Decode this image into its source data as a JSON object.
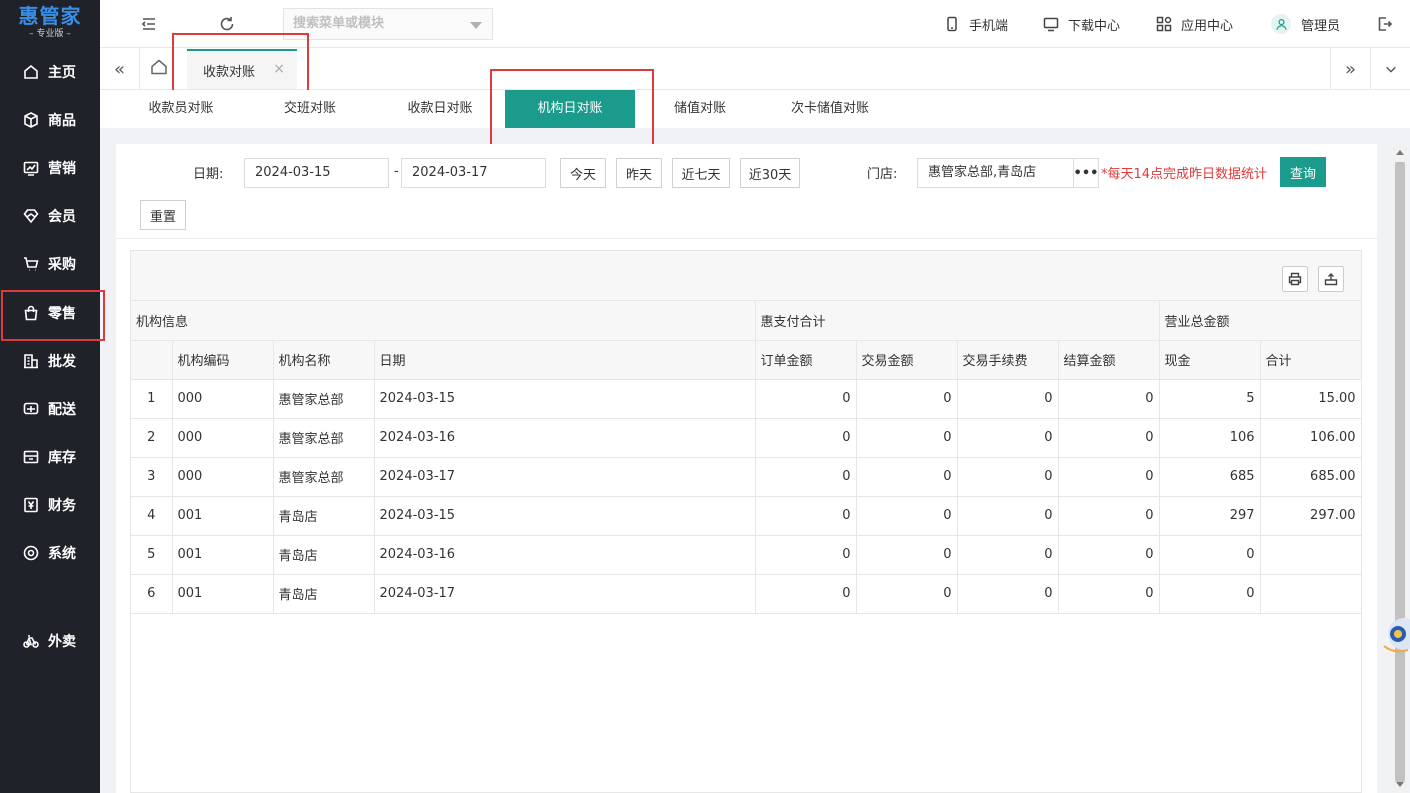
{
  "brand": {
    "name": "惠管家",
    "edition": "– 专业版 –"
  },
  "sidebar": {
    "items": [
      {
        "label": "主页",
        "icon": "home-icon"
      },
      {
        "label": "商品",
        "icon": "box-icon"
      },
      {
        "label": "营销",
        "icon": "chart-icon"
      },
      {
        "label": "会员",
        "icon": "diamond-icon"
      },
      {
        "label": "采购",
        "icon": "cart-icon"
      },
      {
        "label": "零售",
        "icon": "bag-icon"
      },
      {
        "label": "批发",
        "icon": "building-icon"
      },
      {
        "label": "配送",
        "icon": "truck-icon"
      },
      {
        "label": "库存",
        "icon": "inventory-icon"
      },
      {
        "label": "财务",
        "icon": "yen-icon"
      },
      {
        "label": "系统",
        "icon": "settings-icon"
      },
      {
        "label": "外卖",
        "icon": "bike-icon"
      }
    ]
  },
  "header": {
    "search_placeholder": "搜索菜单或模块",
    "mobile": "手机端",
    "download": "下载中心",
    "apps": "应用中心",
    "user": "管理员"
  },
  "tabs": {
    "active": "收款对账",
    "close": "×",
    "left_arrow": "«",
    "right_arrow": "»",
    "dropdown": "⌄"
  },
  "subnav": [
    "收款员对账",
    "交班对账",
    "收款日对账",
    "机构日对账",
    "储值对账",
    "次卡储值对账"
  ],
  "filters": {
    "date_label": "日期:",
    "date_from": "2024-03-15",
    "date_sep": "-",
    "date_to": "2024-03-17",
    "today": "今天",
    "yesterday": "昨天",
    "last7": "近七天",
    "last30": "近30天",
    "store_label": "门店:",
    "store_value": "惠管家总部,青岛店",
    "more": "•••",
    "hint": "*每天14点完成昨日数据统计",
    "query": "查询",
    "reset": "重置"
  },
  "table": {
    "group_headers": [
      "机构信息",
      "惠支付合计",
      "营业总金额"
    ],
    "columns": [
      "",
      "机构编码",
      "机构名称",
      "日期",
      "订单金额",
      "交易金额",
      "交易手续费",
      "结算金额",
      "现金",
      "合计"
    ],
    "rows": [
      [
        "1",
        "000",
        "惠管家总部",
        "2024-03-15",
        "0",
        "0",
        "0",
        "0",
        "5",
        "15.00"
      ],
      [
        "2",
        "000",
        "惠管家总部",
        "2024-03-16",
        "0",
        "0",
        "0",
        "0",
        "106",
        "106.00"
      ],
      [
        "3",
        "000",
        "惠管家总部",
        "2024-03-17",
        "0",
        "0",
        "0",
        "0",
        "685",
        "685.00"
      ],
      [
        "4",
        "001",
        "青岛店",
        "2024-03-15",
        "0",
        "0",
        "0",
        "0",
        "297",
        "297.00"
      ],
      [
        "5",
        "001",
        "青岛店",
        "2024-03-16",
        "0",
        "0",
        "0",
        "0",
        "0",
        ""
      ],
      [
        "6",
        "001",
        "青岛店",
        "2024-03-17",
        "0",
        "0",
        "0",
        "0",
        "0",
        ""
      ]
    ]
  },
  "colors": {
    "sidebar_bg": "#1f2229",
    "accent": "#1a9b8b",
    "highlight": "#e03a3a",
    "brand": "#3a8ee6"
  }
}
